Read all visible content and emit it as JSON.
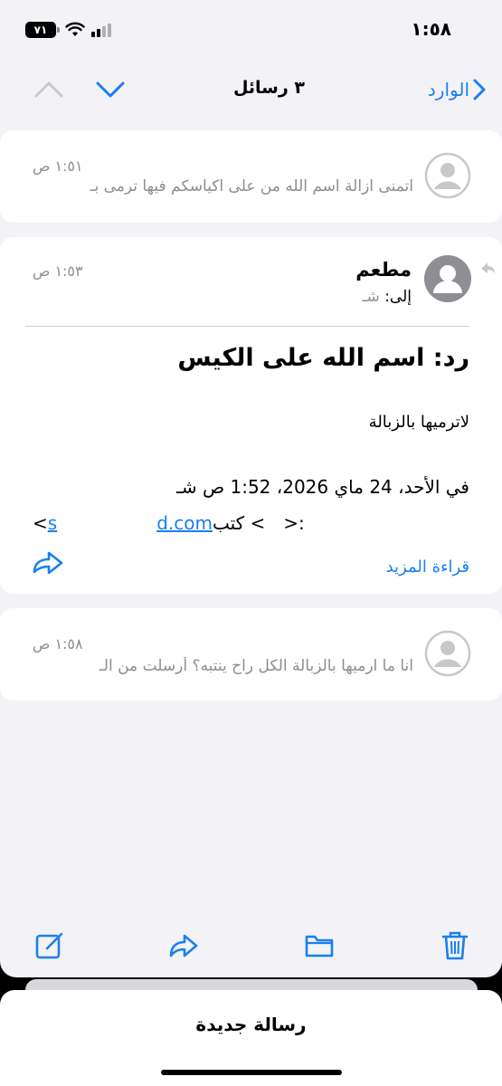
{
  "status_bar": {
    "time": "١:٥٨",
    "battery": "٧١",
    "wifi_icon": "wifi-icon",
    "signal_icon": "cellular-signal-icon"
  },
  "nav": {
    "back_label": "الوارد",
    "title": "٣ رسائل"
  },
  "messages": [
    {
      "time": "١:٥١ ص",
      "preview_line1": "اتمنى ازالة اسم الله من على اكياسكم فيها ترمى بـ",
      "preview_line2": "..."
    },
    {
      "time": "١:٥٣ ص",
      "sender": "مطعم",
      "to_label": "إلى:",
      "to_value": "شـ",
      "subject": "رد: اسم الله على الكيس",
      "body": "لاترميها بالزبالة",
      "quote_header": "في الأحد، 24 ماي 2026، 1:52 ص شـ",
      "quote_writer_prefix": "كتب <",
      "quote_email_start": "s",
      "quote_email_end": "d.com",
      "quote_writer_suffix": ">:",
      "quote_lt": "<",
      "read_more": "قراءة المزيد"
    },
    {
      "time": "١:٥٨ ص",
      "preview_line1": "انا ما ارميها بالزبالة الكل راح ينتبه؟ أُرسلت من الـ",
      "preview_line2": "..."
    }
  ],
  "sheet": {
    "title": "رسالة جديدة"
  },
  "colors": {
    "accent": "#1a7ff0",
    "secondary_text": "#8e8e93",
    "background": "#f2f2f7"
  }
}
